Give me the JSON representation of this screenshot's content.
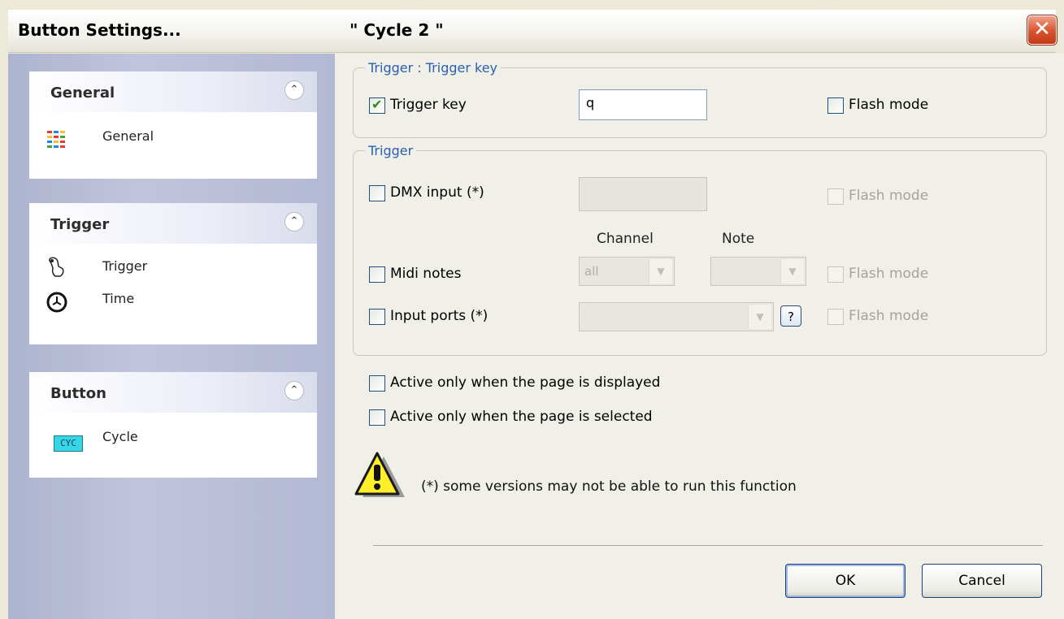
{
  "window": {
    "title": "Button  Settings...",
    "subtitle": "\" Cycle 2 \"",
    "close_glyph": "✕"
  },
  "sidebar": {
    "sections": [
      {
        "title": "General",
        "items": [
          {
            "label": "General",
            "icon": "general-grid-icon"
          }
        ]
      },
      {
        "title": "Trigger",
        "items": [
          {
            "label": "Trigger",
            "icon": "hand-trigger-icon"
          },
          {
            "label": "Time",
            "icon": "clock-icon"
          }
        ]
      },
      {
        "title": "Button",
        "items": [
          {
            "label": "Cycle",
            "icon": "cycle-badge-icon",
            "badge_text": "CYC"
          }
        ]
      }
    ],
    "collapse_glyph": "⌃"
  },
  "trigger_key_group": {
    "legend": "Trigger : Trigger key",
    "trigger_key_label": "Trigger key",
    "trigger_key_checked": true,
    "trigger_key_value": "q",
    "flash_mode_label": "Flash mode"
  },
  "trigger_group": {
    "legend": "Trigger",
    "dmx_label": "DMX input (*)",
    "dmx_flash_label": "Flash mode",
    "channel_header": "Channel",
    "note_header": "Note",
    "midi_label": "Midi notes",
    "midi_channel_value": "all",
    "midi_flash_label": "Flash mode",
    "ports_label": "Input ports (*)",
    "help_label": "?",
    "ports_flash_label": "Flash mode"
  },
  "options": {
    "active_displayed": "Active only when the page is displayed",
    "active_selected": "Active only when the page is selected"
  },
  "warning": {
    "text": "(*) some versions may not be able to run this function"
  },
  "buttons": {
    "ok": "OK",
    "cancel": "Cancel"
  }
}
